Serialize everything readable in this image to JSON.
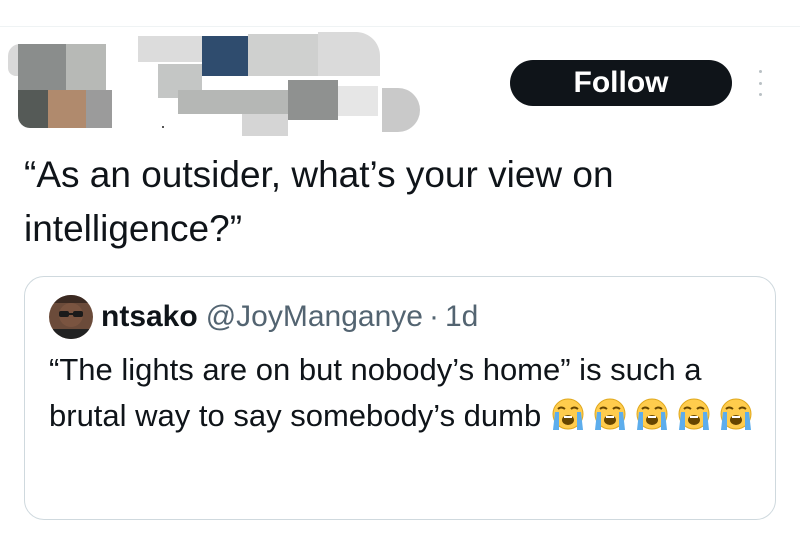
{
  "tweet": {
    "follow_label": "Follow",
    "text": "“As an outsider, what’s your view on intelligence?”"
  },
  "quote": {
    "name": "ntsako",
    "handle": "@JoyManganye",
    "separator": "·",
    "time": "1d",
    "text": "“The lights are on but nobody’s home” is such a brutal way to say somebody’s dumb",
    "emojis": [
      "loudly-crying-face",
      "loudly-crying-face",
      "loudly-crying-face",
      "loudly-crying-face",
      "loudly-crying-face"
    ]
  },
  "colors": {
    "follow_bg": "#0f1419",
    "follow_text": "#ffffff",
    "secondary_text": "#536471",
    "card_border": "#cfd9de",
    "emoji_face": "#ffcc4d",
    "emoji_tears": "#5dadec"
  }
}
